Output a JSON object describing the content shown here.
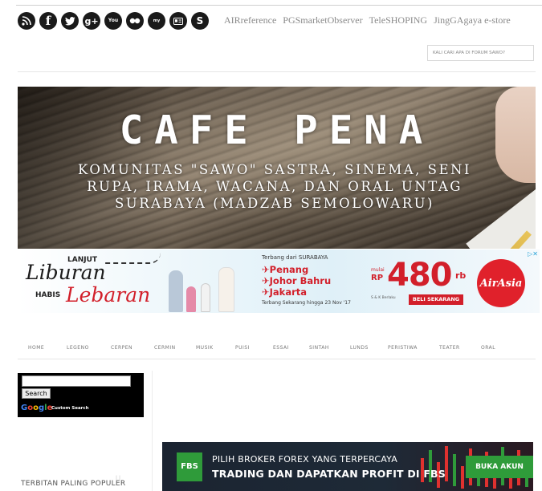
{
  "social_icons": [
    {
      "name": "rss-icon",
      "glyph": "rss"
    },
    {
      "name": "facebook-icon",
      "glyph": "f"
    },
    {
      "name": "twitter-icon",
      "glyph": "tw"
    },
    {
      "name": "google-plus-icon",
      "glyph": "g+"
    },
    {
      "name": "youtube-icon",
      "glyph": "You"
    },
    {
      "name": "flickr-icon",
      "glyph": "••"
    },
    {
      "name": "myspace-icon",
      "glyph": "my"
    },
    {
      "name": "contact-card-icon",
      "glyph": "▣"
    },
    {
      "name": "skype-icon",
      "glyph": "S"
    }
  ],
  "top_links": [
    "AIRreference",
    "PGSmarketObserver",
    "TeleSHOPING",
    "JingGAgaya e-store"
  ],
  "search": {
    "placeholder": "KALI CARI APA DI FORUM SAWO?"
  },
  "banner": {
    "title": "CAFE PENA",
    "subtitle": "KOMUNITAS \"SAWO\" SASTRA, SINEMA, SENI RUPA, IRAMA, WACANA, DAN ORAL UNTAG SURABAYA (MADZAB SEMOLOWARU)"
  },
  "ad_airasia": {
    "lanjut": "LANJUT",
    "liburan": "Liburan",
    "habis": "HABIS",
    "lebaran": "Lebaran",
    "terbang": "Terbang dari SURABAYA",
    "destinations": [
      "✈Penang",
      "✈Johor Bahru",
      "✈Jakarta"
    ],
    "terbang_sekarang": "Terbang Sekarang hingga 23 Nov '17",
    "mulai": "mulai",
    "rp": "RP",
    "price": "480",
    "rb": "rb",
    "sk": "S & K Berlaku",
    "beli": "BELI SEKARANG",
    "brand": "AirAsia",
    "adchoice": "▷✕"
  },
  "nav": [
    "HOME",
    "LEGENO",
    "CERPEN",
    "CERMIN",
    "MUSIK",
    "PUISI",
    "ESSAI",
    "SINTAH",
    "LUNDS",
    "PERISTIWA",
    "TEATER",
    "ORAL"
  ],
  "google_search": {
    "button": "Search",
    "logo": "Google",
    "custom": "Custom Search"
  },
  "sidebar": {
    "popular": "TERBITAN PALING POPULER"
  },
  "ad_fbs": {
    "logo": "FBS",
    "line1": "PILIH BROKER FOREX YANG TERPERCAYA",
    "line2": "TRADING DAN DAPATKAN PROFIT DI FBS",
    "button": "BUKA AKUN"
  }
}
